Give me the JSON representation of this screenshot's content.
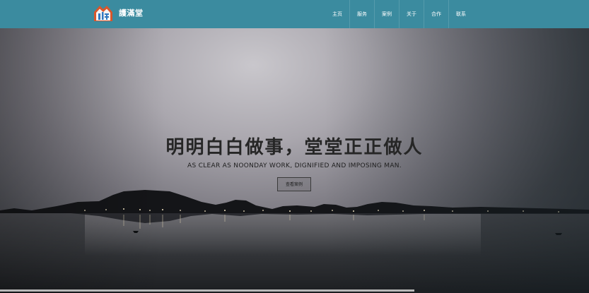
{
  "header": {
    "logo_text": "護滿堂",
    "nav": [
      "主页",
      "服务",
      "案例",
      "关于",
      "合作",
      "联系"
    ]
  },
  "hero": {
    "headline": "明明白白做事，堂堂正正做人",
    "subline": "AS CLEAR AS NOONDAY WORK, DIGNIFIED AND IMPOSING MAN.",
    "cta_label": "查看案例"
  },
  "colors": {
    "navbar": "#3b8b9f",
    "logo_red": "#d8562b",
    "logo_blue": "#2f78c1"
  }
}
